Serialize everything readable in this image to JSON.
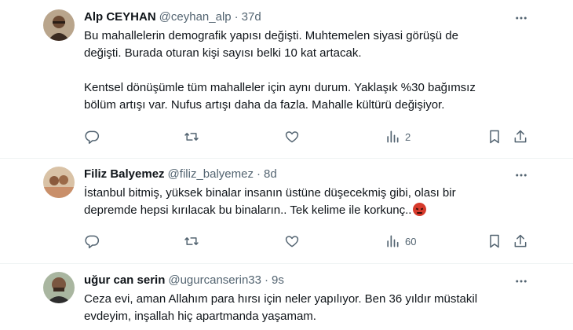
{
  "tweets": [
    {
      "name": "Alp CEYHAN",
      "handle": "@ceyhan_alp",
      "separator": "·",
      "time": "37d",
      "lines": [
        "Bu mahallelerin demografik yapısı değişti. Muhtemelen siyasi görüşü de",
        "değişti. Burada oturan kişi sayısı belki 10 kat artacak.",
        "",
        "Kentsel dönüşümle tüm mahalleler için aynı durum. Yaklaşık %30 bağımsız",
        "bölüm artışı var. Nufus artışı daha da fazla. Mahalle kültürü değişiyor."
      ],
      "views": "2"
    },
    {
      "name": "Filiz Balyemez",
      "handle": "@filiz_balyemez",
      "separator": "·",
      "time": "8d",
      "lines": [
        "İstanbul bitmiş, yüksek binalar insanın üstüne düşecekmiş gibi, olası bir",
        "depremde hepsi kırılacak bu binaların.. Tek kelime ile korkunç.."
      ],
      "emoji": "angry-face-emoji",
      "views": "60"
    },
    {
      "name": "uğur can serin",
      "handle": "@ugurcanserin33",
      "separator": "·",
      "time": "9s",
      "lines": [
        "Ceza evi, aman Allahım para hırsı için neler yapılıyor. Ben 36 yıldır müstakil",
        "evdeyim, inşallah hiç apartmanda yaşamam."
      ]
    }
  ],
  "icons": {
    "reply": "reply-icon",
    "retweet": "retweet-icon",
    "like": "heart-icon",
    "views": "views-icon",
    "bookmark": "bookmark-icon",
    "share": "share-icon",
    "more": "more-icon"
  },
  "colors": {
    "text": "#0f1419",
    "secondary": "#536471",
    "divider": "#eff3f4",
    "emoji": "#d63a2c"
  }
}
